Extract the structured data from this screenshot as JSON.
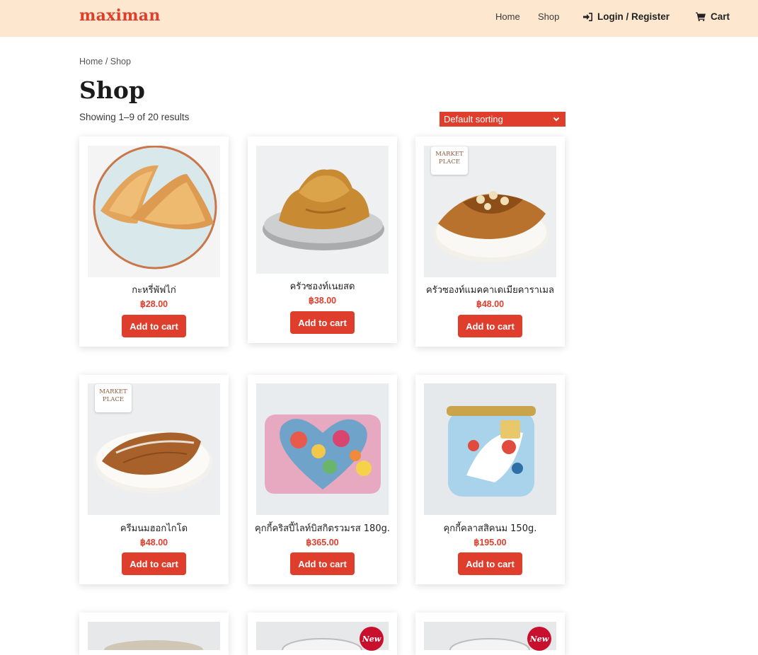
{
  "header": {
    "logo": "maximan",
    "nav": {
      "home": "Home",
      "shop": "Shop",
      "login": "Login / Register",
      "cart": "Cart"
    }
  },
  "breadcrumb": {
    "home": "Home",
    "sep": " / ",
    "current": "Shop"
  },
  "page": {
    "title": "Shop",
    "result_count": "Showing 1–9 of 20 results",
    "sorting": "Default sorting"
  },
  "products": [
    {
      "name": "กะหรี่พัฟไก่",
      "price": "฿28.00",
      "button": "Add to cart",
      "image": "curry-puff-image"
    },
    {
      "name": "ครัวซองท์เนยสด",
      "price": "฿38.00",
      "button": "Add to cart",
      "image": "butter-croissant-image"
    },
    {
      "name": "ครัวซองท์แมคคาเดเมียคาราเมล",
      "price": "฿48.00",
      "button": "Add to cart",
      "image": "macadamia-croissant-image"
    },
    {
      "name": "ครีมนมฮอกไกโด",
      "price": "฿48.00",
      "button": "Add to cart",
      "image": "hokkaido-cream-croissant-image"
    },
    {
      "name": "คุกกี้คริสปี้ไลท์บิสกิตรวมรส 180g.",
      "price": "฿365.00",
      "button": "Add to cart",
      "image": "cookie-tin-floral-image"
    },
    {
      "name": "คุกกี้คลาสสิคนม 150g.",
      "price": "฿195.00",
      "button": "Add to cart",
      "image": "cookie-tin-milk-image"
    }
  ],
  "partial_row": [
    {
      "image": "jar-image",
      "badge": ""
    },
    {
      "image": "jar-image",
      "badge": "New"
    },
    {
      "image": "jar-image",
      "badge": "New"
    }
  ],
  "market_place_logo": "MARKET PLACE",
  "colors": {
    "accent": "#e03e2d",
    "header_bg": "#fde8cf"
  }
}
